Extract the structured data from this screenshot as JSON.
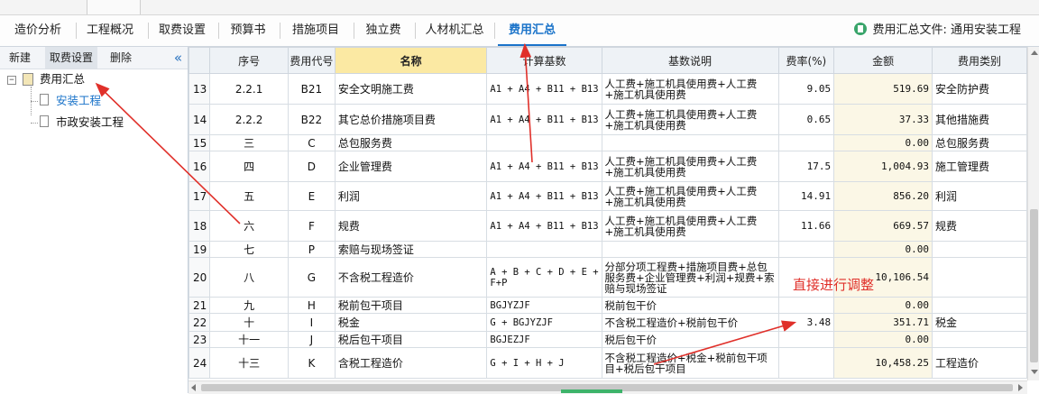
{
  "top_tabs": [
    {
      "label": "造价分析",
      "active": false
    },
    {
      "label": "工程概况",
      "active": false
    },
    {
      "label": "取费设置",
      "active": false
    },
    {
      "label": "预算书",
      "active": false
    },
    {
      "label": "措施项目",
      "active": false
    },
    {
      "label": "独立费",
      "active": false
    },
    {
      "label": "人材机汇总",
      "active": false
    },
    {
      "label": "费用汇总",
      "active": true
    }
  ],
  "file_info": "费用汇总文件: 通用安装工程",
  "left_toolbar": {
    "new": "新建",
    "fee_setting": "取费设置",
    "delete": "删除"
  },
  "tree": {
    "root": "费用汇总",
    "children": [
      "安装工程",
      "市政安装工程"
    ]
  },
  "columns": [
    "序号",
    "费用代号",
    "名称",
    "计算基数",
    "基数说明",
    "费率(%)",
    "金额",
    "费用类别"
  ],
  "rows": [
    {
      "idx": "13",
      "seq": "2.2.1",
      "code": "B21",
      "name": "安全文明施工费",
      "base": "A1 + A4 + B11 + B13",
      "desc": "人工费+施工机具使用费+人工费+施工机具使用费",
      "rate": "9.05",
      "amount": "519.69",
      "category": "安全防护费"
    },
    {
      "idx": "14",
      "seq": "2.2.2",
      "code": "B22",
      "name": "其它总价措施项目费",
      "base": "A1 + A4 + B11 + B13",
      "desc": "人工费+施工机具使用费+人工费+施工机具使用费",
      "rate": "0.65",
      "amount": "37.33",
      "category": "其他措施费"
    },
    {
      "idx": "15",
      "seq": "三",
      "code": "C",
      "name": "总包服务费",
      "base": "",
      "desc": "",
      "rate": "",
      "amount": "0.00",
      "category": "总包服务费"
    },
    {
      "idx": "16",
      "seq": "四",
      "code": "D",
      "name": "企业管理费",
      "base": "A1 + A4 + B11 + B13",
      "desc": "人工费+施工机具使用费+人工费+施工机具使用费",
      "rate": "17.5",
      "amount": "1,004.93",
      "category": "施工管理费"
    },
    {
      "idx": "17",
      "seq": "五",
      "code": "E",
      "name": "利润",
      "base": "A1 + A4 + B11 + B13",
      "desc": "人工费+施工机具使用费+人工费+施工机具使用费",
      "rate": "14.91",
      "amount": "856.20",
      "category": "利润"
    },
    {
      "idx": "18",
      "seq": "六",
      "code": "F",
      "name": "规费",
      "base": "A1 + A4 + B11 + B13",
      "desc": "人工费+施工机具使用费+人工费+施工机具使用费",
      "rate": "11.66",
      "amount": "669.57",
      "category": "规费"
    },
    {
      "idx": "19",
      "seq": "七",
      "code": "P",
      "name": "索赔与现场签证",
      "base": "",
      "desc": "",
      "rate": "",
      "amount": "0.00",
      "category": ""
    },
    {
      "idx": "20",
      "seq": "八",
      "code": "G",
      "name": "不含税工程造价",
      "base": "A + B + C + D + E + F+P",
      "desc": "分部分项工程费+措施项目费+总包服务费+企业管理费+利润+规费+索赔与现场签证",
      "rate": "",
      "amount": "10,106.54",
      "category": ""
    },
    {
      "idx": "21",
      "seq": "九",
      "code": "H",
      "name": "税前包干项目",
      "base": "BGJYZJF",
      "desc": "税前包干价",
      "rate": "",
      "amount": "0.00",
      "category": ""
    },
    {
      "idx": "22",
      "seq": "十",
      "code": "I",
      "name": "税金",
      "base": "G + BGJYZJF",
      "desc": "不含税工程造价+税前包干价",
      "rate": "3.48",
      "amount": "351.71",
      "category": "税金"
    },
    {
      "idx": "23",
      "seq": "十一",
      "code": "J",
      "name": "税后包干项目",
      "base": "BGJEZJF",
      "desc": "税后包干价",
      "rate": "",
      "amount": "0.00",
      "category": ""
    },
    {
      "idx": "24",
      "seq": "十三",
      "code": "K",
      "name": "含税工程造价",
      "base": "G + I + H + J",
      "desc": "不含税工程造价+税金+税前包干项目+税后包干项目",
      "rate": "",
      "amount": "10,458.25",
      "category": "工程造价"
    }
  ],
  "annotation": "直接进行调整",
  "colors": {
    "accent": "#1a73c9",
    "annotation": "#e0302a",
    "name_header": "#fbe9a3"
  }
}
